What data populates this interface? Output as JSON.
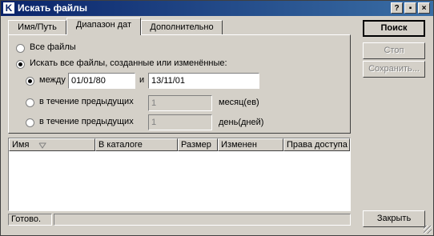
{
  "window": {
    "title": "Искать файлы",
    "app_icon": "K",
    "help_label": "?",
    "minimize_label": "▪",
    "close_label": "×"
  },
  "tabs": [
    {
      "label": "Имя/Путь",
      "active": false
    },
    {
      "label": "Диапазон дат",
      "active": true
    },
    {
      "label": "Дополнительно",
      "active": false
    }
  ],
  "date_range": {
    "all_files_label": "Все файлы",
    "all_files_checked": false,
    "find_modified_label": "Искать все файлы, созданные или изменённые:",
    "find_modified_checked": true,
    "between_label": "между",
    "between_checked": true,
    "from_value": "01/01/80",
    "and_label": "и",
    "to_value": "13/11/01",
    "prev_months_label": "в течение предыдущих",
    "prev_months_value": "1",
    "months_unit": "месяц(ев)",
    "prev_days_label": "в течение предыдущих",
    "prev_days_value": "1",
    "days_unit": "день(дней)"
  },
  "buttons": {
    "search": "Поиск",
    "stop": "Стоп",
    "save": "Сохранить...",
    "close": "Закрыть"
  },
  "results": {
    "columns": [
      "Имя",
      "В каталоге",
      "Размер",
      "Изменен",
      "Права доступа"
    ]
  },
  "status": {
    "text": "Готово.",
    "detail": ""
  },
  "colors": {
    "titlebar_start": "#0a246a",
    "titlebar_end": "#3a6ea5",
    "face": "#d4d0c8"
  }
}
